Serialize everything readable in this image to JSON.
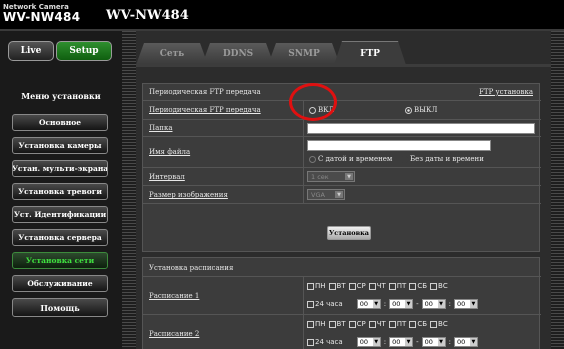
{
  "header": {
    "brand_small": "Network Camera",
    "brand_big": "WV-NW484",
    "model": "WV-NW484"
  },
  "sidebar": {
    "live": "Live",
    "setup": "Setup",
    "menu_title": "Меню установки",
    "items": [
      {
        "label": "Основное"
      },
      {
        "label": "Установка камеры"
      },
      {
        "label": "Устан. мульти-экрана"
      },
      {
        "label": "Установка тревоги"
      },
      {
        "label": "Уст. Идентификации"
      },
      {
        "label": "Установка сервера"
      },
      {
        "label": "Установка сети",
        "active": true
      },
      {
        "label": "Обслуживание"
      }
    ],
    "help": "Помощь"
  },
  "tabs": [
    {
      "label": "Сеть"
    },
    {
      "label": "DDNS"
    },
    {
      "label": "SNMP"
    },
    {
      "label": "FTP",
      "active": true
    }
  ],
  "ftp": {
    "section_title": "Периодическая FTP передача",
    "link": "FTP установка",
    "periodic_label": "Периодическая FTP передача",
    "on_label": "ВКЛ",
    "off_label": "ВЫКЛ",
    "off_selected": true,
    "folder_label": "Папка",
    "folder_value": "",
    "filename_label": "Имя файла",
    "filename_value": "",
    "with_datetime": "С датой и временем",
    "without_datetime": "Без даты и времени",
    "interval_label": "Интервал",
    "interval_value": "1 сек",
    "image_size_label": "Размер изображения",
    "image_size_value": "VGA",
    "install_button": "Установка"
  },
  "schedule": {
    "title": "Установка расписания",
    "days": [
      "ПН",
      "ВТ",
      "СР",
      "ЧТ",
      "ПТ",
      "СБ",
      "ВС"
    ],
    "all_day": "24 часа",
    "time_values": [
      "00",
      "00",
      "00",
      "00"
    ],
    "separators": [
      ":",
      "-",
      ":"
    ],
    "rows": [
      {
        "label": "Расписание 1"
      },
      {
        "label": "Расписание 2"
      }
    ]
  },
  "colors": {
    "active_green": "#3fe03f",
    "highlight_red": "#e01010",
    "setup_green": "#2f8f2f"
  }
}
